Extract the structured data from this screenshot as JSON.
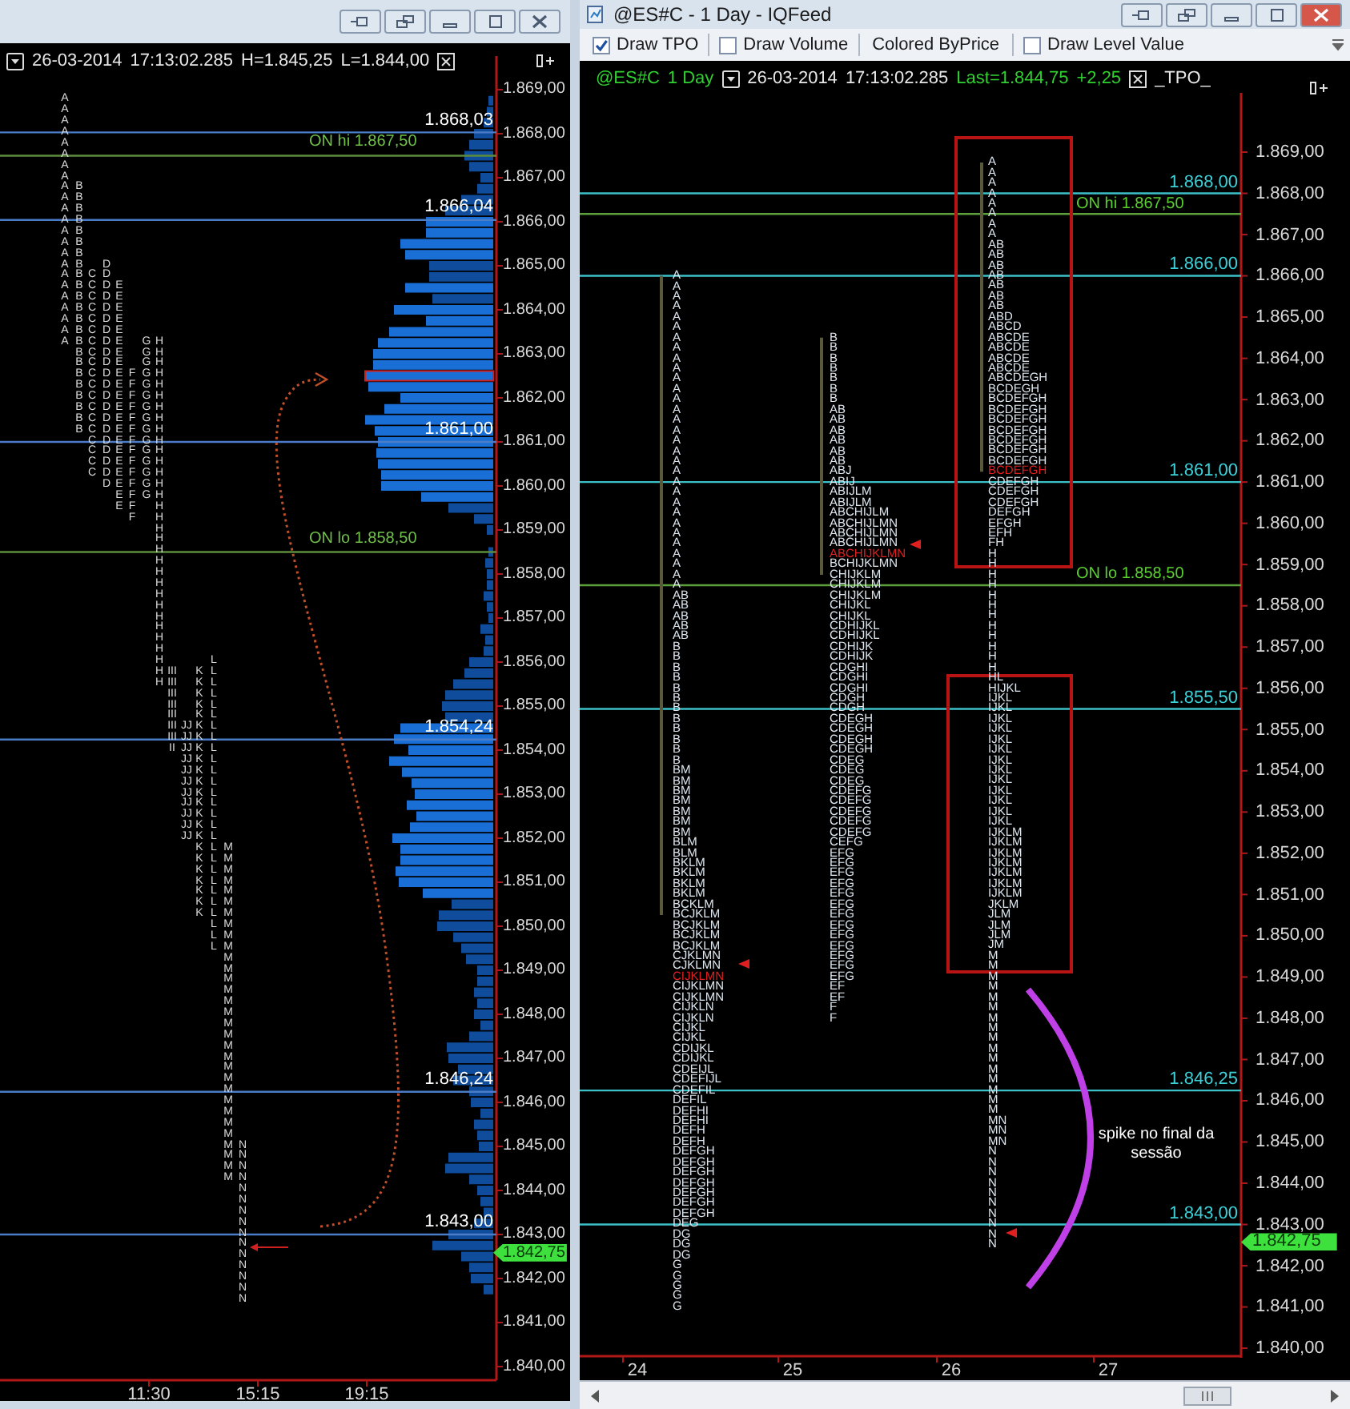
{
  "left_chart": {
    "header": {
      "date": "26-03-2014",
      "time": "17:13:02.285",
      "high": "H=1.845,25",
      "low": "L=1.844,00"
    },
    "levels": [
      {
        "kind": "value",
        "label": "1.868,03"
      },
      {
        "kind": "overnight",
        "label": "ON hi 1.867,50"
      },
      {
        "kind": "value",
        "label": "1.866,04"
      },
      {
        "kind": "value",
        "label": "1.861,00"
      },
      {
        "kind": "overnight",
        "label": "ON lo 1.858,50"
      },
      {
        "kind": "value",
        "label": "1.854,24"
      },
      {
        "kind": "value",
        "label": "1.846,24"
      },
      {
        "kind": "value",
        "label": "1.843,00"
      }
    ],
    "tpo_columns": [
      "AAAAAAAAAAAAAAAAAAAAAAA",
      "BBBBBBBBBBBBBBBBBBBBBBB",
      "CCCCCCCCCCCCCCCCCCC",
      "DDDDDDDDDDDDDDDDDDDDD",
      "EEEEEEEEEEEEEEEEEEEEE",
      "FFFFFFFFFFFFFF",
      "GGGGGGGGGGGGGGG",
      "HHHHHHHHHHHHHHHHHHHHHHHHHHHHHHHH",
      "IIIIIIIIIIIIIIIIIIIIIII",
      "JJJJJJJJJJJJJJJJJJJJJJ",
      "KKKKKKKKKKKKKKKKKKKKKKK",
      "LLLLLLLLLLLLLLLLLLLLLLLLLLL",
      "MMMMMMMMMMMMMMMMMMMMMMMMMMMMMMM",
      "NNNNNNNNNNNNNNN"
    ],
    "price_axis": [
      "1.869,00",
      "1.868,00",
      "1.867,00",
      "1.866,00",
      "1.865,00",
      "1.864,00",
      "1.863,00",
      "1.862,00",
      "1.861,00",
      "1.860,00",
      "1.859,00",
      "1.858,00",
      "1.857,00",
      "1.856,00",
      "1.855,00",
      "1.854,00",
      "1.853,00",
      "1.852,00",
      "1.851,00",
      "1.850,00",
      "1.849,00",
      "1.848,00",
      "1.847,00",
      "1.846,00",
      "1.845,00",
      "1.844,00",
      "1.843,00",
      "1.842,00",
      "1.841,00",
      "1.840,00"
    ],
    "current_price": "1.842,75",
    "time_axis": [
      "11:30",
      "15:15",
      "19:15"
    ]
  },
  "right_chart": {
    "window": {
      "title": "@ES#C - 1 Day - IQFeed"
    },
    "toolbar": [
      {
        "kind": "checkbox",
        "label": "Draw TPO",
        "checked": true
      },
      {
        "kind": "checkbox",
        "label": "Draw Volume",
        "checked": false
      },
      {
        "kind": "button",
        "label": "Colored ByPrice"
      },
      {
        "kind": "checkbox",
        "label": "Draw Level Value",
        "checked": false
      }
    ],
    "header": {
      "symbol": "@ES#C",
      "period": "1 Day",
      "date": "26-03-2014",
      "time": "17:13:02.285",
      "last": "Last=1.844,75",
      "change": "+2,25",
      "study": "_TPO_"
    },
    "levels": [
      {
        "kind": "value",
        "label": "1.868,00"
      },
      {
        "kind": "overnight",
        "label": "ON hi 1.867,50"
      },
      {
        "kind": "value",
        "label": "1.866,00"
      },
      {
        "kind": "value",
        "label": "1.861,00"
      },
      {
        "kind": "overnight",
        "label": "ON lo 1.858,50"
      },
      {
        "kind": "value",
        "label": "1.855,50"
      },
      {
        "kind": "value",
        "label": "1.846,25"
      },
      {
        "kind": "value",
        "label": "1.843,00"
      }
    ],
    "profiles": [
      {
        "rows": [
          "A",
          "A",
          "A",
          "A",
          "A",
          "A",
          "A",
          "A",
          "A",
          "A",
          "A",
          "A",
          "A",
          "A",
          "A",
          "A",
          "A",
          "A",
          "A",
          "A",
          "A",
          "A",
          "A",
          "A",
          "A",
          "A",
          "A",
          "A",
          "A",
          "A",
          "A",
          "AB",
          "AB",
          "AB",
          "AB",
          "AB",
          "B",
          "B",
          "B",
          "B",
          "B",
          "B",
          "B",
          "B",
          "B",
          "B",
          "B",
          "B",
          "BM",
          "BM",
          "BM",
          "BM",
          "BM",
          "BM",
          "BM",
          "BLM",
          "BLM",
          "BKLM",
          "BKLM",
          "BKLM",
          "BKLM",
          "BCKLM",
          "BCJKLM",
          "BCJKLM",
          "BCJKLM",
          "BCJKLM",
          "CJKLMN",
          "CJKLMN",
          {
            "text": "CIJKLMN",
            "highlighted": true
          },
          "CIJKLMN",
          "CIJKLMN",
          "CIJKLN",
          "CIJKLN",
          "CIJKL",
          "CIJKL",
          "CDIJKL",
          "CDIJKL",
          "CDEIJL",
          "CDEFIJL",
          "CDEFIL",
          "DEFIL",
          "DEFHI",
          "DEFHI",
          "DEFH",
          "DEFH",
          "DEFGH",
          "DEFGH",
          "DEFGH",
          "DEFGH",
          "DEFGH",
          "DEFGH",
          "DEFGH",
          "DEG",
          "DG",
          "DG",
          "DG",
          "G",
          "G",
          "G",
          "G",
          "G"
        ]
      },
      {
        "rows": [
          "B",
          "B",
          "B",
          "B",
          "B",
          "B",
          "B",
          "AB",
          "AB",
          "AB",
          "AB",
          "AB",
          "AB",
          "ABJ",
          "ABIJ",
          "ABIJLM",
          "ABIJLM",
          "ABCHIJLM",
          "ABCHIJLMN",
          "ABCHIJLMN",
          "ABCHIJLMN",
          {
            "text": "ABCHIJKLMN",
            "highlighted": true
          },
          "BCHIJKLMN",
          "CHIJKLM",
          "CHIJKLM",
          "CHIJKLM",
          "CHIJKL",
          "CHIJKL",
          "CDHIJKL",
          "CDHIJKL",
          "CDHIJK",
          "CDHIJK",
          "CDGHI",
          "CDGHI",
          "CDGHI",
          "CDGH",
          "CDGH",
          "CDEGH",
          "CDEGH",
          "CDEGH",
          "CDEGH",
          "CDEG",
          "CDEG",
          "CDEG",
          "CDEFG",
          "CDEFG",
          "CDEFG",
          "CDEFG",
          "CDEFG",
          "CEFG",
          "EFG",
          "EFG",
          "EFG",
          "EFG",
          "EFG",
          "EFG",
          "EFG",
          "EFG",
          "EFG",
          "EFG",
          "EFG",
          "EFG",
          "EFG",
          "EF",
          "EF",
          "F",
          "F"
        ]
      },
      {
        "rows": [
          "A",
          "A",
          "A",
          "A",
          "A",
          "A",
          "A",
          "A",
          "AB",
          "AB",
          "AB",
          "AB",
          "AB",
          "AB",
          "AB",
          "ABD",
          "ABCD",
          "ABCDE",
          "ABCDE",
          "ABCDE",
          "ABCDE",
          "ABCDEGH",
          "BCDEGH",
          "BCDEFGH",
          "BCDEFGH",
          "BCDEFGH",
          "BCDEFGH",
          "BCDEFGH",
          "BCDEFGH",
          "BCDEFGH",
          {
            "text": "BCDEFGH",
            "highlighted": true
          },
          "CDEFGH",
          "CDEFGH",
          "CDEFGH",
          "DEFGH",
          "EFGH",
          "EFH",
          "FH",
          "H",
          "H",
          "H",
          "H",
          "H",
          "H",
          "H",
          "H",
          "H",
          "H",
          "H",
          "H",
          "HL",
          "HIJKL",
          "IJKL",
          "IJKL",
          "IJKL",
          "IJKL",
          "IJKL",
          "IJKL",
          "IJKL",
          "IJKL",
          "IJKL",
          "IJKL",
          "IJKL",
          "IJKL",
          "IJKL",
          "IJKLM",
          "IJKLM",
          "IJKLM",
          "IJKLM",
          "IJKLM",
          "IJKLM",
          "IJKLM",
          "JKLM",
          "JLM",
          "JLM",
          "JLM",
          "JM",
          "M",
          "M",
          "M",
          "M",
          "M",
          "M",
          "M",
          "M",
          "M",
          "M",
          "M",
          "M",
          "M",
          "M",
          "M",
          "M",
          "MN",
          "MN",
          "MN",
          "N",
          "N",
          "N",
          "N",
          "N",
          "N",
          "N",
          "N",
          "N",
          "N"
        ]
      }
    ],
    "annotation": "spike no final da sessão",
    "price_axis": [
      "1.869,00",
      "1.868,00",
      "1.867,00",
      "1.866,00",
      "1.865,00",
      "1.864,00",
      "1.863,00",
      "1.862,00",
      "1.861,00",
      "1.860,00",
      "1.859,00",
      "1.858,00",
      "1.857,00",
      "1.856,00",
      "1.855,00",
      "1.854,00",
      "1.853,00",
      "1.852,00",
      "1.851,00",
      "1.850,00",
      "1.849,00",
      "1.848,00",
      "1.847,00",
      "1.846,00",
      "1.845,00",
      "1.844,00",
      "1.843,00",
      "1.842,00",
      "1.841,00",
      "1.840,00"
    ],
    "current_price": "1.842,75",
    "date_axis": [
      "24",
      "25",
      "26",
      "27"
    ]
  }
}
